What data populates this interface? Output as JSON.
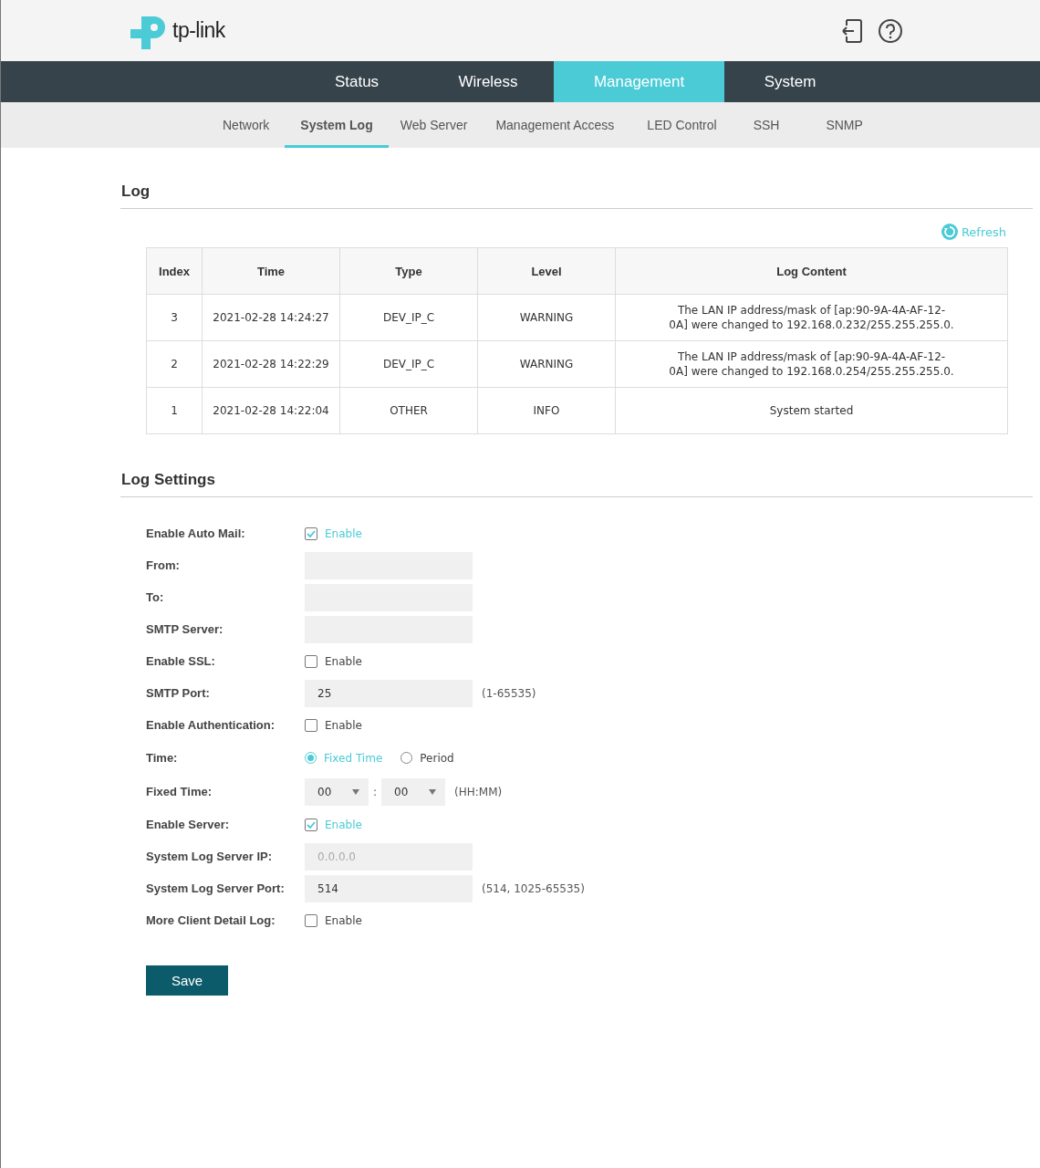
{
  "logo": {
    "text": "tp-link"
  },
  "main_tabs": [
    {
      "label": "Status",
      "selected": false
    },
    {
      "label": "Wireless",
      "selected": false
    },
    {
      "label": "Management",
      "selected": true
    },
    {
      "label": "System",
      "selected": false
    }
  ],
  "sub_tabs": [
    {
      "label": "Network",
      "selected": false
    },
    {
      "label": "System Log",
      "selected": true
    },
    {
      "label": "Web Server",
      "selected": false
    },
    {
      "label": "Management Access",
      "selected": false
    },
    {
      "label": "LED Control",
      "selected": false
    },
    {
      "label": "SSH",
      "selected": false
    },
    {
      "label": "SNMP",
      "selected": false
    }
  ],
  "log": {
    "title": "Log",
    "refresh": "Refresh",
    "table": {
      "columns": [
        "Index",
        "Time",
        "Type",
        "Level",
        "Log Content"
      ],
      "rows": [
        [
          "3",
          "2021-02-28 14:24:27",
          "DEV_IP_C",
          "WARNING",
          "The LAN IP address/mask of [ap:90-9A-4A-AF-12-0A] were changed to 192.168.0.232/255.255.255.0."
        ],
        [
          "2",
          "2021-02-28 14:22:29",
          "DEV_IP_C",
          "WARNING",
          "The LAN IP address/mask of [ap:90-9A-4A-AF-12-0A] were changed to 192.168.0.254/255.255.255.0."
        ],
        [
          "1",
          "2021-02-28 14:22:04",
          "OTHER",
          "INFO",
          "System started"
        ]
      ]
    }
  },
  "log_settings": {
    "title": "Log Settings",
    "rows": [
      {
        "kind": "checkbox",
        "label": "Enable Auto Mail:",
        "text": "Enable",
        "checked": true
      },
      {
        "kind": "text",
        "label": "From:"
      },
      {
        "kind": "text",
        "label": "To:"
      },
      {
        "kind": "text",
        "label": "SMTP Server:"
      },
      {
        "kind": "checkbox",
        "label": "Enable SSL:",
        "text": "Enable",
        "checked": false
      },
      {
        "kind": "text",
        "label": "SMTP Port:",
        "value": "25",
        "hint": "(1-65535)"
      },
      {
        "kind": "checkbox",
        "label": "Enable Authentication:",
        "text": "Enable",
        "checked": false
      },
      {
        "kind": "radio",
        "label": "Time:",
        "options": [
          {
            "label": "Fixed Time",
            "selected": true
          },
          {
            "label": "Period",
            "selected": false
          }
        ]
      },
      {
        "kind": "time",
        "label": "Fixed Time:",
        "hour": "00",
        "separator": ":",
        "minute": "00",
        "hint": "(HH:MM)"
      },
      {
        "kind": "checkbox",
        "label": "Enable Server:",
        "text": "Enable",
        "checked": true
      },
      {
        "kind": "text",
        "label": "System Log Server IP:",
        "placeholder": "0.0.0.0"
      },
      {
        "kind": "text",
        "label": "System Log Server Port:",
        "value": "514",
        "hint": "(514, 1025-65535)"
      },
      {
        "kind": "checkbox",
        "label": "More Client Detail Log:",
        "text": "Enable",
        "checked": false
      }
    ],
    "save": "Save"
  }
}
